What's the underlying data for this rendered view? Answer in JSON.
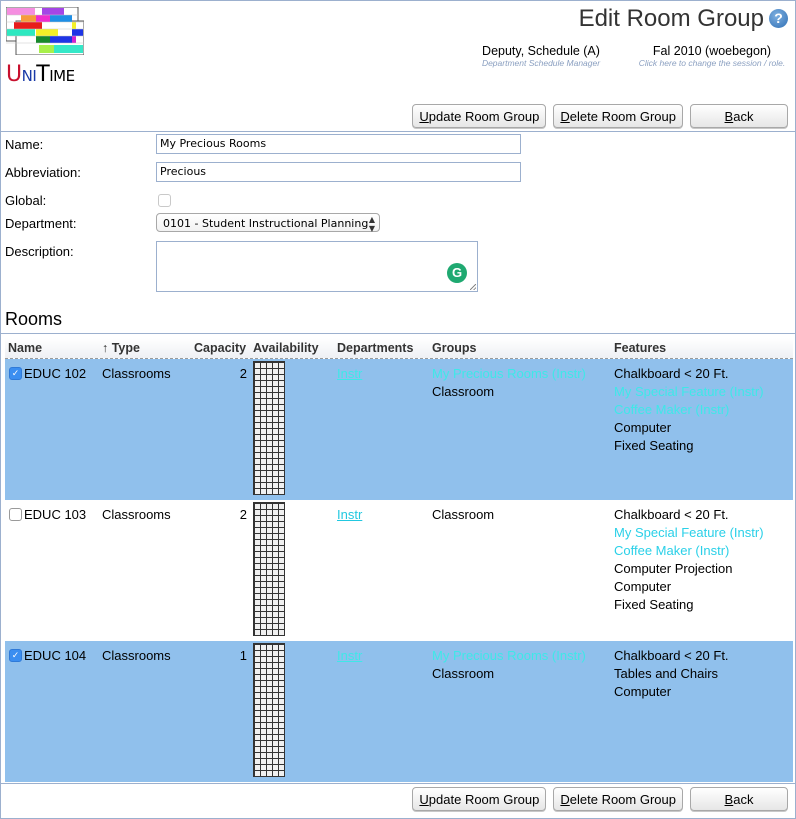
{
  "app": {
    "logo_text": [
      "U",
      "NI",
      "I",
      "T",
      "IME"
    ],
    "logo_alt": "UniTime"
  },
  "header": {
    "title": "Edit Room Group",
    "help_icon": "?",
    "user": {
      "name": "Deputy, Schedule (A)",
      "role": "Department Schedule Manager"
    },
    "session": {
      "name": "Fal 2010 (woebegon)",
      "hint": "Click here to change the session / role."
    }
  },
  "buttons": {
    "update": {
      "accesskey": "U",
      "rest": "pdate Room Group"
    },
    "delete": {
      "accesskey": "D",
      "rest": "elete Room Group"
    },
    "back": {
      "accesskey": "B",
      "rest": "ack"
    }
  },
  "form": {
    "name_label": "Name:",
    "name_value": "My Precious Rooms",
    "abbreviation_label": "Abbreviation:",
    "abbreviation_value": "Precious",
    "global_label": "Global:",
    "global_checked": false,
    "department_label": "Department:",
    "department_value": "0101 - Student Instructional Planning",
    "description_label": "Description:",
    "description_value": ""
  },
  "rooms": {
    "title": "Rooms",
    "columns": [
      "Name",
      "↑ Type",
      "Capacity",
      "Availability",
      "Departments",
      "Groups",
      "Features"
    ],
    "rows": [
      {
        "selected": true,
        "name": "EDUC 102",
        "type": "Classrooms",
        "capacity": "2",
        "department": "Instr",
        "groups": [
          {
            "text": "My Precious Rooms (Instr)",
            "highlight": true
          },
          {
            "text": "Classroom",
            "highlight": false
          }
        ],
        "features": [
          {
            "text": "Chalkboard < 20 Ft.",
            "highlight": false
          },
          {
            "text": "My Special Feature (Instr)",
            "highlight": true
          },
          {
            "text": "Coffee Maker (Instr)",
            "highlight": true
          },
          {
            "text": "Computer",
            "highlight": false
          },
          {
            "text": "Fixed Seating",
            "highlight": false
          }
        ]
      },
      {
        "selected": false,
        "name": "EDUC 103",
        "type": "Classrooms",
        "capacity": "2",
        "department": "Instr",
        "groups": [
          {
            "text": "Classroom",
            "highlight": false
          }
        ],
        "features": [
          {
            "text": "Chalkboard < 20 Ft.",
            "highlight": false
          },
          {
            "text": "My Special Feature (Instr)",
            "highlight": true
          },
          {
            "text": "Coffee Maker (Instr)",
            "highlight": true
          },
          {
            "text": "Computer Projection",
            "highlight": false
          },
          {
            "text": "Computer",
            "highlight": false
          },
          {
            "text": "Fixed Seating",
            "highlight": false
          }
        ]
      },
      {
        "selected": true,
        "name": "EDUC 104",
        "type": "Classrooms",
        "capacity": "1",
        "department": "Instr",
        "groups": [
          {
            "text": "My Precious Rooms (Instr)",
            "highlight": true
          },
          {
            "text": "Classroom",
            "highlight": false
          }
        ],
        "features": [
          {
            "text": "Chalkboard < 20 Ft.",
            "highlight": false
          },
          {
            "text": "Tables and Chairs",
            "highlight": false
          },
          {
            "text": "Computer",
            "highlight": false
          }
        ]
      }
    ]
  },
  "colors": {
    "selected_row": "#90c0ec",
    "highlight_text": "#3ee8e8",
    "frame_border": "#9cb0ce"
  }
}
